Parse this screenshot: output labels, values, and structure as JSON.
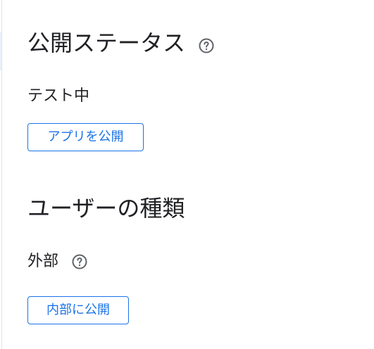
{
  "publish_status": {
    "title": "公開ステータス",
    "help_icon": "help-circle-outline",
    "status": "テスト中",
    "button_label": "アプリを公開"
  },
  "user_type": {
    "title": "ユーザーの種類",
    "value": "外部",
    "help_icon": "help-circle-outline",
    "button_label": "内部に公開"
  },
  "colors": {
    "accent": "#1a73e8",
    "text": "#202124",
    "icon": "#5f6368"
  }
}
